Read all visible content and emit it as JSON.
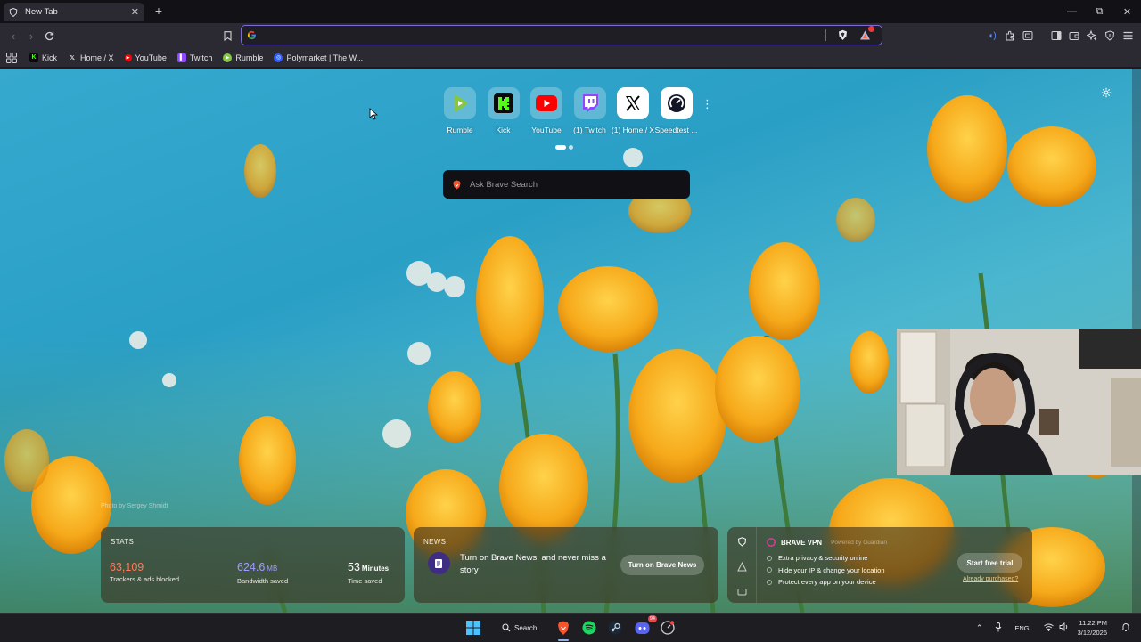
{
  "browser": {
    "tab_title": "New Tab",
    "new_tab_glyph": "+",
    "url_value": "",
    "window_controls": {
      "minimize": "—",
      "maximize": "⧉",
      "close": "✕"
    }
  },
  "bookmarks": [
    {
      "label": "Kick",
      "icon": "kick-icon",
      "color": "#53fc18"
    },
    {
      "label": "Home / X",
      "icon": "x-icon",
      "color": "#000000"
    },
    {
      "label": "YouTube",
      "icon": "youtube-icon",
      "color": "#ff0000"
    },
    {
      "label": "Twitch",
      "icon": "twitch-icon",
      "color": "#9146ff"
    },
    {
      "label": "Rumble",
      "icon": "rumble-icon",
      "color": "#85c742"
    },
    {
      "label": "Polymarket | The W...",
      "icon": "polymarket-icon",
      "color": "#2e5cff"
    }
  ],
  "top_sites": [
    {
      "label": "Rumble",
      "icon": "rumble-icon"
    },
    {
      "label": "Kick",
      "icon": "kick-icon"
    },
    {
      "label": "YouTube",
      "icon": "youtube-icon"
    },
    {
      "label": "(1) Twitch",
      "icon": "twitch-icon"
    },
    {
      "label": "(1) Home / X",
      "icon": "x-icon"
    },
    {
      "label": "Speedtest ...",
      "icon": "speedtest-icon"
    }
  ],
  "search": {
    "placeholder": "Ask Brave Search"
  },
  "photo_credit": "Photo by Sergey Shmidt",
  "stats": {
    "title": "STATS",
    "trackers": {
      "value": "63,109",
      "caption": "Trackers & ads blocked",
      "color": "#ff7b5c"
    },
    "bandwidth": {
      "value": "624.6",
      "unit": "MB",
      "caption": "Bandwidth saved",
      "color": "#a29bff"
    },
    "time": {
      "value": "53",
      "unit": "Minutes",
      "caption": "Time saved",
      "color": "#ffffff"
    }
  },
  "news": {
    "title": "NEWS",
    "text": "Turn on Brave News, and never miss a story",
    "button": "Turn on Brave News"
  },
  "vpn": {
    "title": "BRAVE VPN",
    "powered_by": "Powered by Guardian",
    "features": [
      "Extra privacy & security online",
      "Hide your IP & change your location",
      "Protect every app on your device"
    ],
    "button": "Start free trial",
    "link": "Already purchased?"
  },
  "taskbar": {
    "search_label": "Search",
    "language": "ENG",
    "time": "11:22 PM",
    "date": "3/12/2026",
    "discord_badge": "94"
  }
}
